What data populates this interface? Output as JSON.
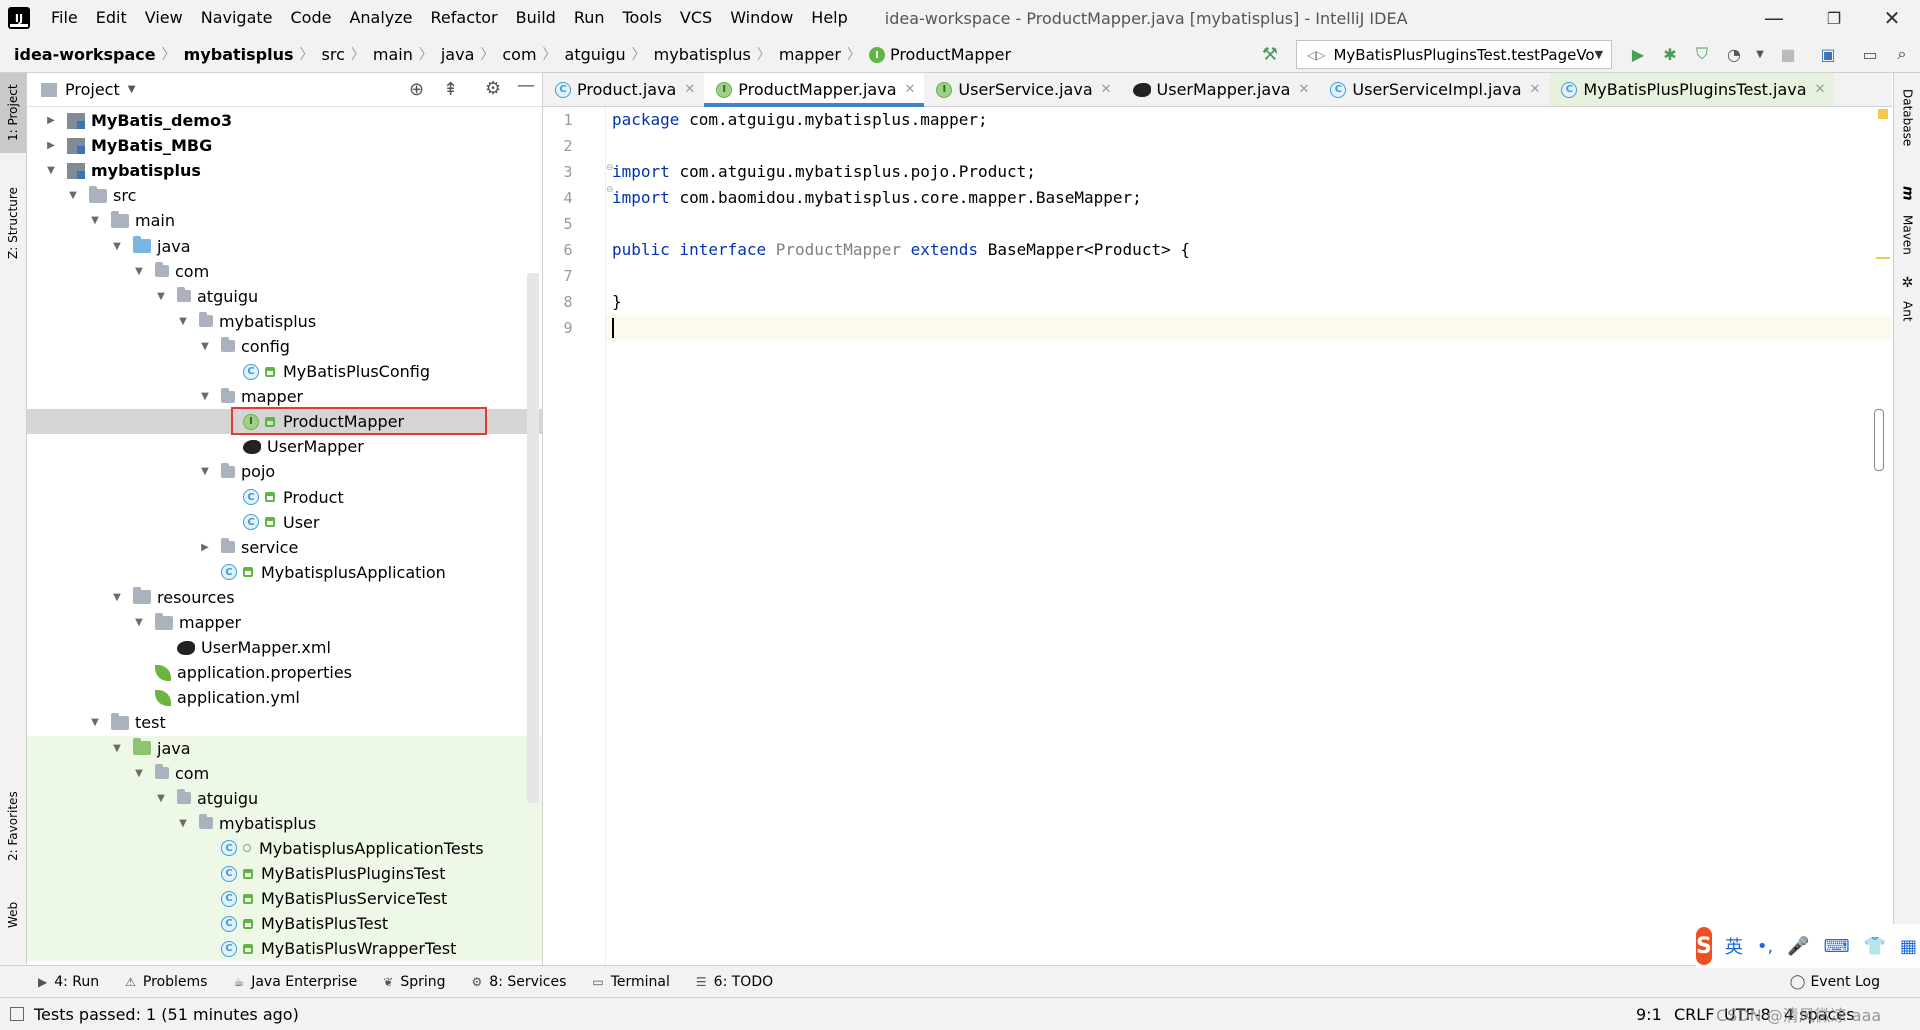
{
  "menubar": {
    "logo": "IJ",
    "items": [
      "File",
      "Edit",
      "View",
      "Navigate",
      "Code",
      "Analyze",
      "Refactor",
      "Build",
      "Run",
      "Tools",
      "VCS",
      "Window",
      "Help"
    ],
    "mnemonics": [
      "F",
      "E",
      "V",
      "N",
      "C",
      "z",
      "R",
      "B",
      "u",
      "T",
      "S",
      "W",
      "H"
    ],
    "title": "idea-workspace - ProductMapper.java [mybatisplus] - IntelliJ IDEA",
    "minimize": "—",
    "restore": "❐",
    "close": "✕"
  },
  "breadcrumb": [
    "idea-workspace",
    "mybatisplus",
    "src",
    "main",
    "java",
    "com",
    "atguigu",
    "mybatisplus",
    "mapper",
    "ProductMapper"
  ],
  "breadcrumb_last_badge": "I",
  "run_config": {
    "label": "MyBatisPlusPluginsTest.testPageVo",
    "dropdown": "▼"
  },
  "icons": {
    "build": "hammer-icon",
    "run": "run-icon",
    "debug": "debug-icon",
    "coverage": "coverage-icon",
    "profile": "profile-icon",
    "stop": "stop-icon",
    "project_structure": "project-structure-icon",
    "search": "search-icon",
    "colors": {
      "run": "#499c54",
      "accent": "#4083c9",
      "selection_box": "#e53935",
      "test_bg": "#eef8e6",
      "caret_line": "#fcfaed",
      "keyword": "#0033b3"
    }
  },
  "left_stripe": {
    "project": "1: Project",
    "structure": "Z: Structure",
    "favorites": "2: Favorites",
    "web": "Web"
  },
  "project_panel": {
    "title": "Project",
    "dropdown": "▼",
    "tree": [
      {
        "label": "MyBatis_demo3",
        "bold": true,
        "expanded": false,
        "icon": "module",
        "depth": 0
      },
      {
        "label": "MyBatis_MBG",
        "bold": true,
        "expanded": false,
        "icon": "module",
        "depth": 0
      },
      {
        "label": "mybatisplus",
        "bold": true,
        "expanded": true,
        "icon": "module",
        "depth": 0
      },
      {
        "label": "src",
        "expanded": true,
        "icon": "folder",
        "depth": 1
      },
      {
        "label": "main",
        "expanded": true,
        "icon": "folder",
        "depth": 2
      },
      {
        "label": "java",
        "expanded": true,
        "icon": "folder-blue",
        "depth": 3
      },
      {
        "label": "com",
        "expanded": true,
        "icon": "package",
        "depth": 4
      },
      {
        "label": "atguigu",
        "expanded": true,
        "icon": "package",
        "depth": 5
      },
      {
        "label": "mybatisplus",
        "expanded": true,
        "icon": "package",
        "depth": 6
      },
      {
        "label": "config",
        "expanded": true,
        "icon": "package",
        "depth": 7
      },
      {
        "label": "MyBatisPlusConfig",
        "icon": "class",
        "depth": 8
      },
      {
        "label": "mapper",
        "expanded": true,
        "icon": "package",
        "depth": 7
      },
      {
        "label": "ProductMapper",
        "icon": "interface",
        "depth": 8,
        "selected": true
      },
      {
        "label": "UserMapper",
        "icon": "mybatis",
        "depth": 8
      },
      {
        "label": "pojo",
        "expanded": true,
        "icon": "package",
        "depth": 7
      },
      {
        "label": "Product",
        "icon": "class",
        "depth": 8
      },
      {
        "label": "User",
        "icon": "class",
        "depth": 8
      },
      {
        "label": "service",
        "expanded": false,
        "icon": "package",
        "depth": 7
      },
      {
        "label": "MybatisplusApplication",
        "icon": "springboot",
        "depth": 7
      },
      {
        "label": "resources",
        "expanded": true,
        "icon": "folder-res",
        "depth": 3
      },
      {
        "label": "mapper",
        "expanded": true,
        "icon": "folder",
        "depth": 4
      },
      {
        "label": "UserMapper.xml",
        "icon": "mybatis",
        "depth": 5
      },
      {
        "label": "application.properties",
        "icon": "spring",
        "depth": 4
      },
      {
        "label": "application.yml",
        "icon": "spring",
        "depth": 4
      },
      {
        "label": "test",
        "expanded": true,
        "icon": "folder",
        "depth": 2
      },
      {
        "label": "java",
        "expanded": true,
        "icon": "folder-green",
        "depth": 3,
        "test": true
      },
      {
        "label": "com",
        "expanded": true,
        "icon": "package",
        "depth": 4,
        "test": true
      },
      {
        "label": "atguigu",
        "expanded": true,
        "icon": "package",
        "depth": 5,
        "test": true
      },
      {
        "label": "mybatisplus",
        "expanded": true,
        "icon": "package",
        "depth": 6,
        "test": true
      },
      {
        "label": "MybatisplusApplicationTests",
        "icon": "testclass",
        "depth": 7,
        "test": true
      },
      {
        "label": "MyBatisPlusPluginsTest",
        "icon": "testclass",
        "depth": 7,
        "test": true
      },
      {
        "label": "MyBatisPlusServiceTest",
        "icon": "testclass",
        "depth": 7,
        "test": true
      },
      {
        "label": "MyBatisPlusTest",
        "icon": "testclass",
        "depth": 7,
        "test": true
      },
      {
        "label": "MyBatisPlusWrapperTest",
        "icon": "testclass",
        "depth": 7,
        "test": true
      }
    ]
  },
  "editor_tabs": [
    {
      "label": "Product.java",
      "icon": "C"
    },
    {
      "label": "ProductMapper.java",
      "icon": "I",
      "active": true
    },
    {
      "label": "UserService.java",
      "icon": "I"
    },
    {
      "label": "UserMapper.java",
      "icon": "mybatis"
    },
    {
      "label": "UserServiceImpl.java",
      "icon": "C"
    },
    {
      "label": "MyBatisPlusPluginsTest.java",
      "icon": "C",
      "test": true
    }
  ],
  "tab_close": "✕",
  "editor": {
    "line_numbers": [
      "1",
      "2",
      "3",
      "4",
      "5",
      "6",
      "7",
      "8",
      "9"
    ],
    "lines": [
      [
        {
          "t": "package ",
          "k": true
        },
        {
          "t": "com.atguigu.mybatisplus.mapper;"
        }
      ],
      [],
      [
        {
          "t": "import ",
          "k": true
        },
        {
          "t": "com.atguigu.mybatisplus.pojo.Product;"
        }
      ],
      [
        {
          "t": "import ",
          "k": true
        },
        {
          "t": "com.baomidou.mybatisplus.core.mapper.BaseMapper;"
        }
      ],
      [],
      [
        {
          "t": "public interface ",
          "k": true
        },
        {
          "t": "ProductMapper ",
          "g": true
        },
        {
          "t": "extends ",
          "k": true
        },
        {
          "t": "BaseMapper<Product> {"
        }
      ],
      [],
      [
        {
          "t": "}"
        }
      ],
      []
    ],
    "caret_line": 9,
    "caret_position": "9:1"
  },
  "right_stripe": {
    "database": "Database",
    "maven": "Maven",
    "ant": "Ant",
    "maven_icon": "m"
  },
  "bottom_tabs": [
    {
      "label": "4: Run",
      "icon": "▶"
    },
    {
      "label": "Problems",
      "icon": "⚠"
    },
    {
      "label": "Java Enterprise",
      "icon": "☕"
    },
    {
      "label": "Spring",
      "icon": "❦"
    },
    {
      "label": "8: Services",
      "icon": "⚙"
    },
    {
      "label": "Terminal",
      "icon": "▭"
    },
    {
      "label": "6: TODO",
      "icon": "☰"
    }
  ],
  "event_log": "Event Log",
  "status": {
    "message": "Tests passed: 1 (51 minutes ago)",
    "position": "9:1",
    "line_sep": "CRLF",
    "encoding": "UTF-8",
    "indent": "4 spaces",
    "watermark": "CSDN @清风微凉 aaa"
  },
  "ime": {
    "logo": "S",
    "lang": "英",
    "items": [
      "•,",
      "🎤",
      "⌨",
      "👕",
      "▦"
    ]
  }
}
